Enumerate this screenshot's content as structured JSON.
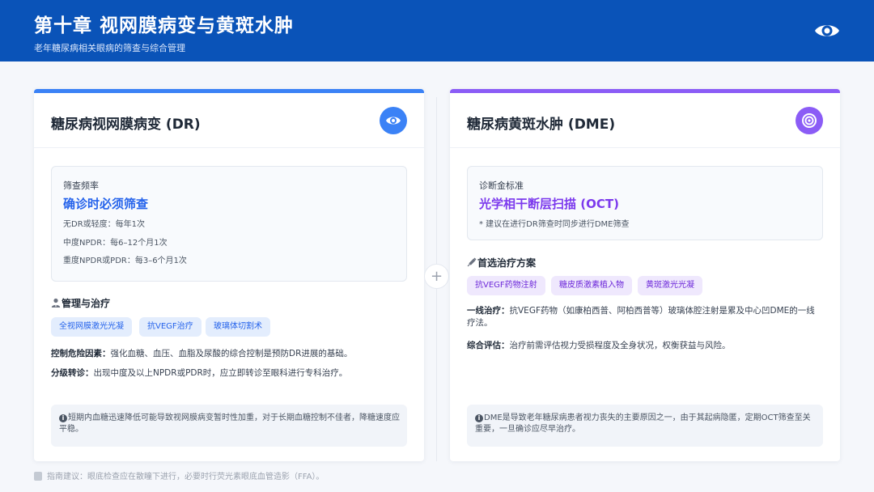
{
  "header": {
    "title": "第十章 视网膜病变与黄斑水肿",
    "subtitle": "老年糖尿病相关眼病的筛查与综合管理",
    "icon": "eye-icon"
  },
  "dr_card": {
    "title": "糖尿病视网膜病变 (DR)",
    "icon": "eye-icon",
    "screening": {
      "label": "筛查频率",
      "headline": "确诊时必须筛查",
      "lines": [
        "无DR或轻度：每年1次",
        "中度NPDR：每6–12个月1次",
        "重度NPDR或PDR：每3–6个月1次"
      ]
    },
    "management_title": "管理与治疗",
    "tags": [
      "全视网膜激光光凝",
      "抗VEGF治疗",
      "玻璃体切割术"
    ],
    "risk": {
      "label": "控制危险因素：",
      "text": "强化血糖、血压、血脂及尿酸的综合控制是预防DR进展的基础。"
    },
    "referral": {
      "label": "分级转诊：",
      "text": "出现中度及以上NPDR或PDR时，应立即转诊至眼科进行专科治疗。"
    },
    "note": "短期内血糖迅速降低可能导致视网膜病变暂时性加重，对于长期血糖控制不佳者，降糖速度应平稳。"
  },
  "dme_card": {
    "title": "糖尿病黄斑水肿 (DME)",
    "icon": "target-icon",
    "diagnosis": {
      "label": "诊断金标准",
      "headline": "光学相干断层扫描 (OCT)",
      "line": "* 建议在进行DR筛查时同步进行DME筛查"
    },
    "treatment_title": "首选治疗方案",
    "tags": [
      "抗VEGF药物注射",
      "糖皮质激素植入物",
      "黄斑激光光凝"
    ],
    "first_line": {
      "label": "一线治疗：",
      "text": "抗VEGF药物（如康柏西普、阿柏西普等）玻璃体腔注射是累及中心凹DME的一线疗法。"
    },
    "assessment": {
      "label": "综合评估：",
      "text": "治疗前需评估视力受损程度及全身状况，权衡获益与风险。"
    },
    "note": "DME是导致老年糖尿病患者视力丧失的主要原因之一，由于其起病隐匿，定期OCT筛查至关重要，一旦确诊应尽早治疗。"
  },
  "divider_symbol": "+",
  "footer": {
    "text": "指南建议：眼底检查应在散瞳下进行，必要时行荧光素眼底血管造影（FFA）。"
  },
  "colors": {
    "header_bg": "#0a53b8",
    "dr_accent": "#3b82f6",
    "dme_accent": "#8b5cf6"
  }
}
